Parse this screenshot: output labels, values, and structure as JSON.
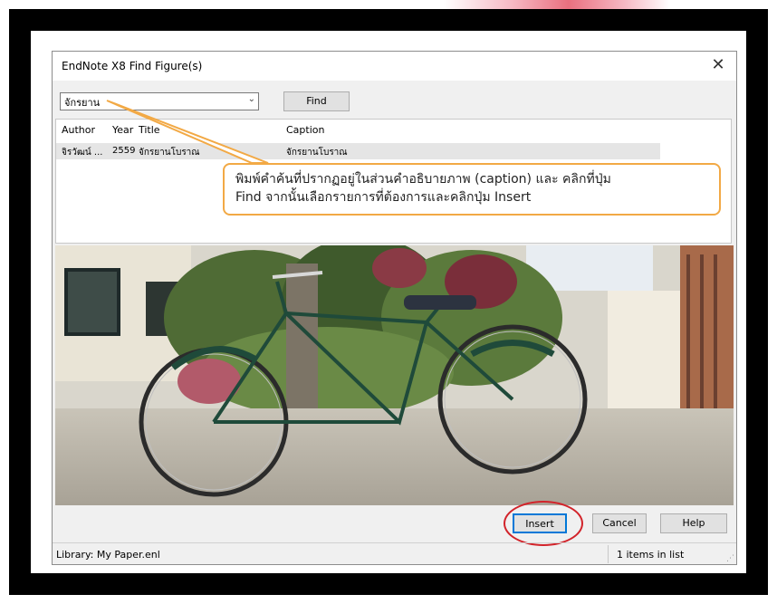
{
  "dialog": {
    "title": "EndNote X8 Find Figure(s)",
    "close_glyph": "✕"
  },
  "search": {
    "value": "จักรยาน",
    "dropdown_icon": "chevron-down-icon",
    "find_label": "Find"
  },
  "results": {
    "columns": [
      "Author",
      "Year",
      "Title",
      "Caption"
    ],
    "rows": [
      {
        "author": "จิรวัฒน์ ...",
        "year": "2559",
        "title": "จักรยานโบราณ",
        "caption": "จักรยานโบราณ"
      }
    ]
  },
  "callout": {
    "line1": "พิมพ์คำค้นที่ปรากฏอยู่ในส่วนคำอธิบายภาพ (caption) และ คลิกที่ปุ่ม",
    "line2": "Find จากนั้นเลือกรายการที่ต้องการและคลิกปุ่ม Insert"
  },
  "buttons": {
    "insert": "Insert",
    "cancel": "Cancel",
    "help": "Help"
  },
  "status": {
    "library": "Library: My Paper.enl",
    "count": "1 items in list"
  },
  "colors": {
    "callout_border": "#f2a945",
    "highlight_circle": "#d2232a",
    "frame": "#000000"
  }
}
